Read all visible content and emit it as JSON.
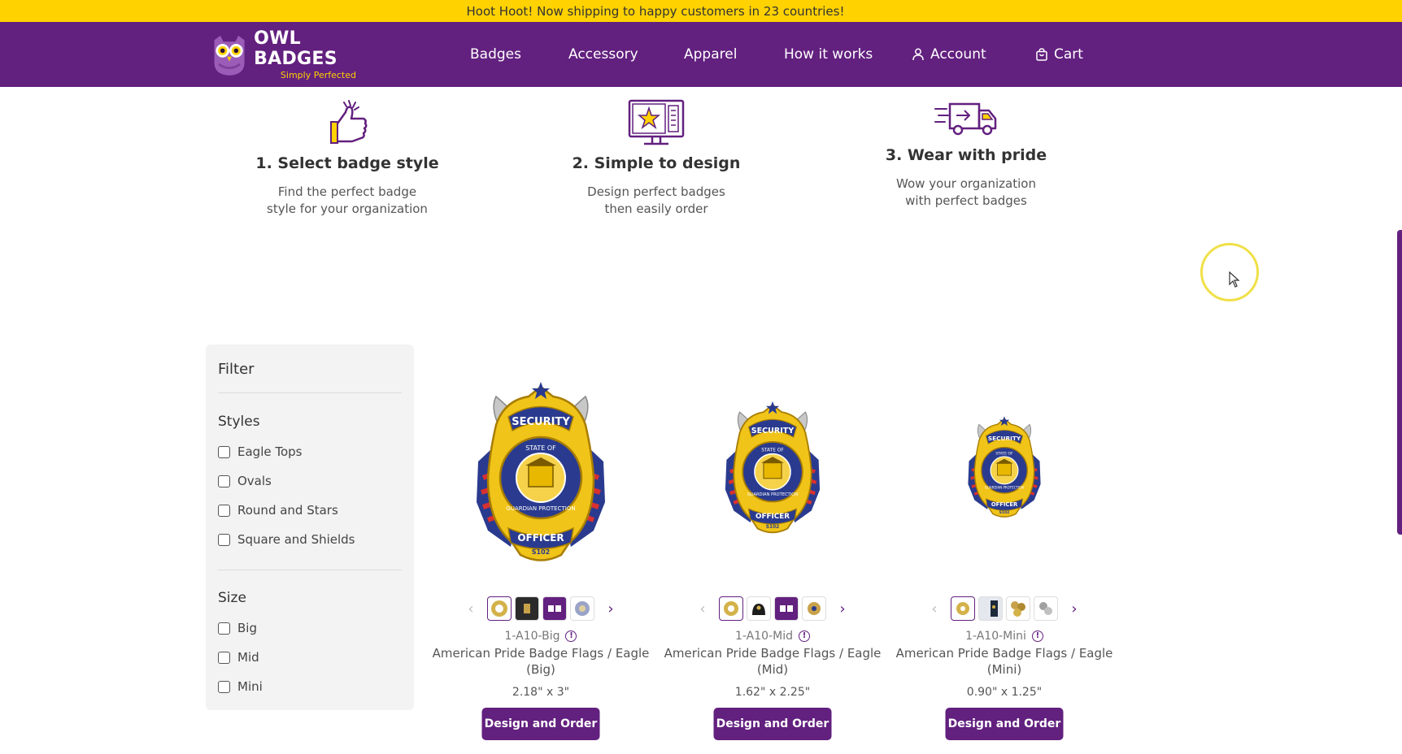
{
  "announcement": "Hoot Hoot! Now shipping to happy customers in 23 countries!",
  "brand": {
    "name": "OWL BADGES",
    "tagline": "Simply Perfected"
  },
  "nav": {
    "items": [
      "Badges",
      "Accessory",
      "Apparel",
      "How it works"
    ],
    "account": "Account",
    "cart": "Cart"
  },
  "steps": [
    {
      "title": "1. Select badge style",
      "desc": "Find the perfect badge style for your organization",
      "icon": "thumbs-up-icon"
    },
    {
      "title": "2. Simple to design",
      "desc": "Design perfect badges then easily order",
      "icon": "design-monitor-icon"
    },
    {
      "title": "3. Wear with pride",
      "desc": "Wow your organization with perfect badges",
      "icon": "delivery-truck-icon"
    }
  ],
  "filter": {
    "title": "Filter",
    "styles_title": "Styles",
    "styles": [
      "Eagle Tops",
      "Ovals",
      "Round and Stars",
      "Square and Shields"
    ],
    "size_title": "Size",
    "sizes": [
      "Big",
      "Mid",
      "Mini"
    ]
  },
  "products": [
    {
      "sku": "1-A10-Big",
      "name": "American Pride Badge Flags / Eagle (Big)",
      "size": "2.18\" x 3\"",
      "button": "Design and Order"
    },
    {
      "sku": "1-A10-Mid",
      "name": "American Pride Badge Flags / Eagle (Mid)",
      "size": "1.62\" x 2.25\"",
      "button": "Design and Order"
    },
    {
      "sku": "1-A10-Mini",
      "name": "American Pride Badge Flags / Eagle (Mini)",
      "size": "0.90\" x 1.25\"",
      "button": "Design and Order"
    }
  ],
  "colors": {
    "brand_purple": "#62207f",
    "brand_yellow": "#ffd200"
  }
}
